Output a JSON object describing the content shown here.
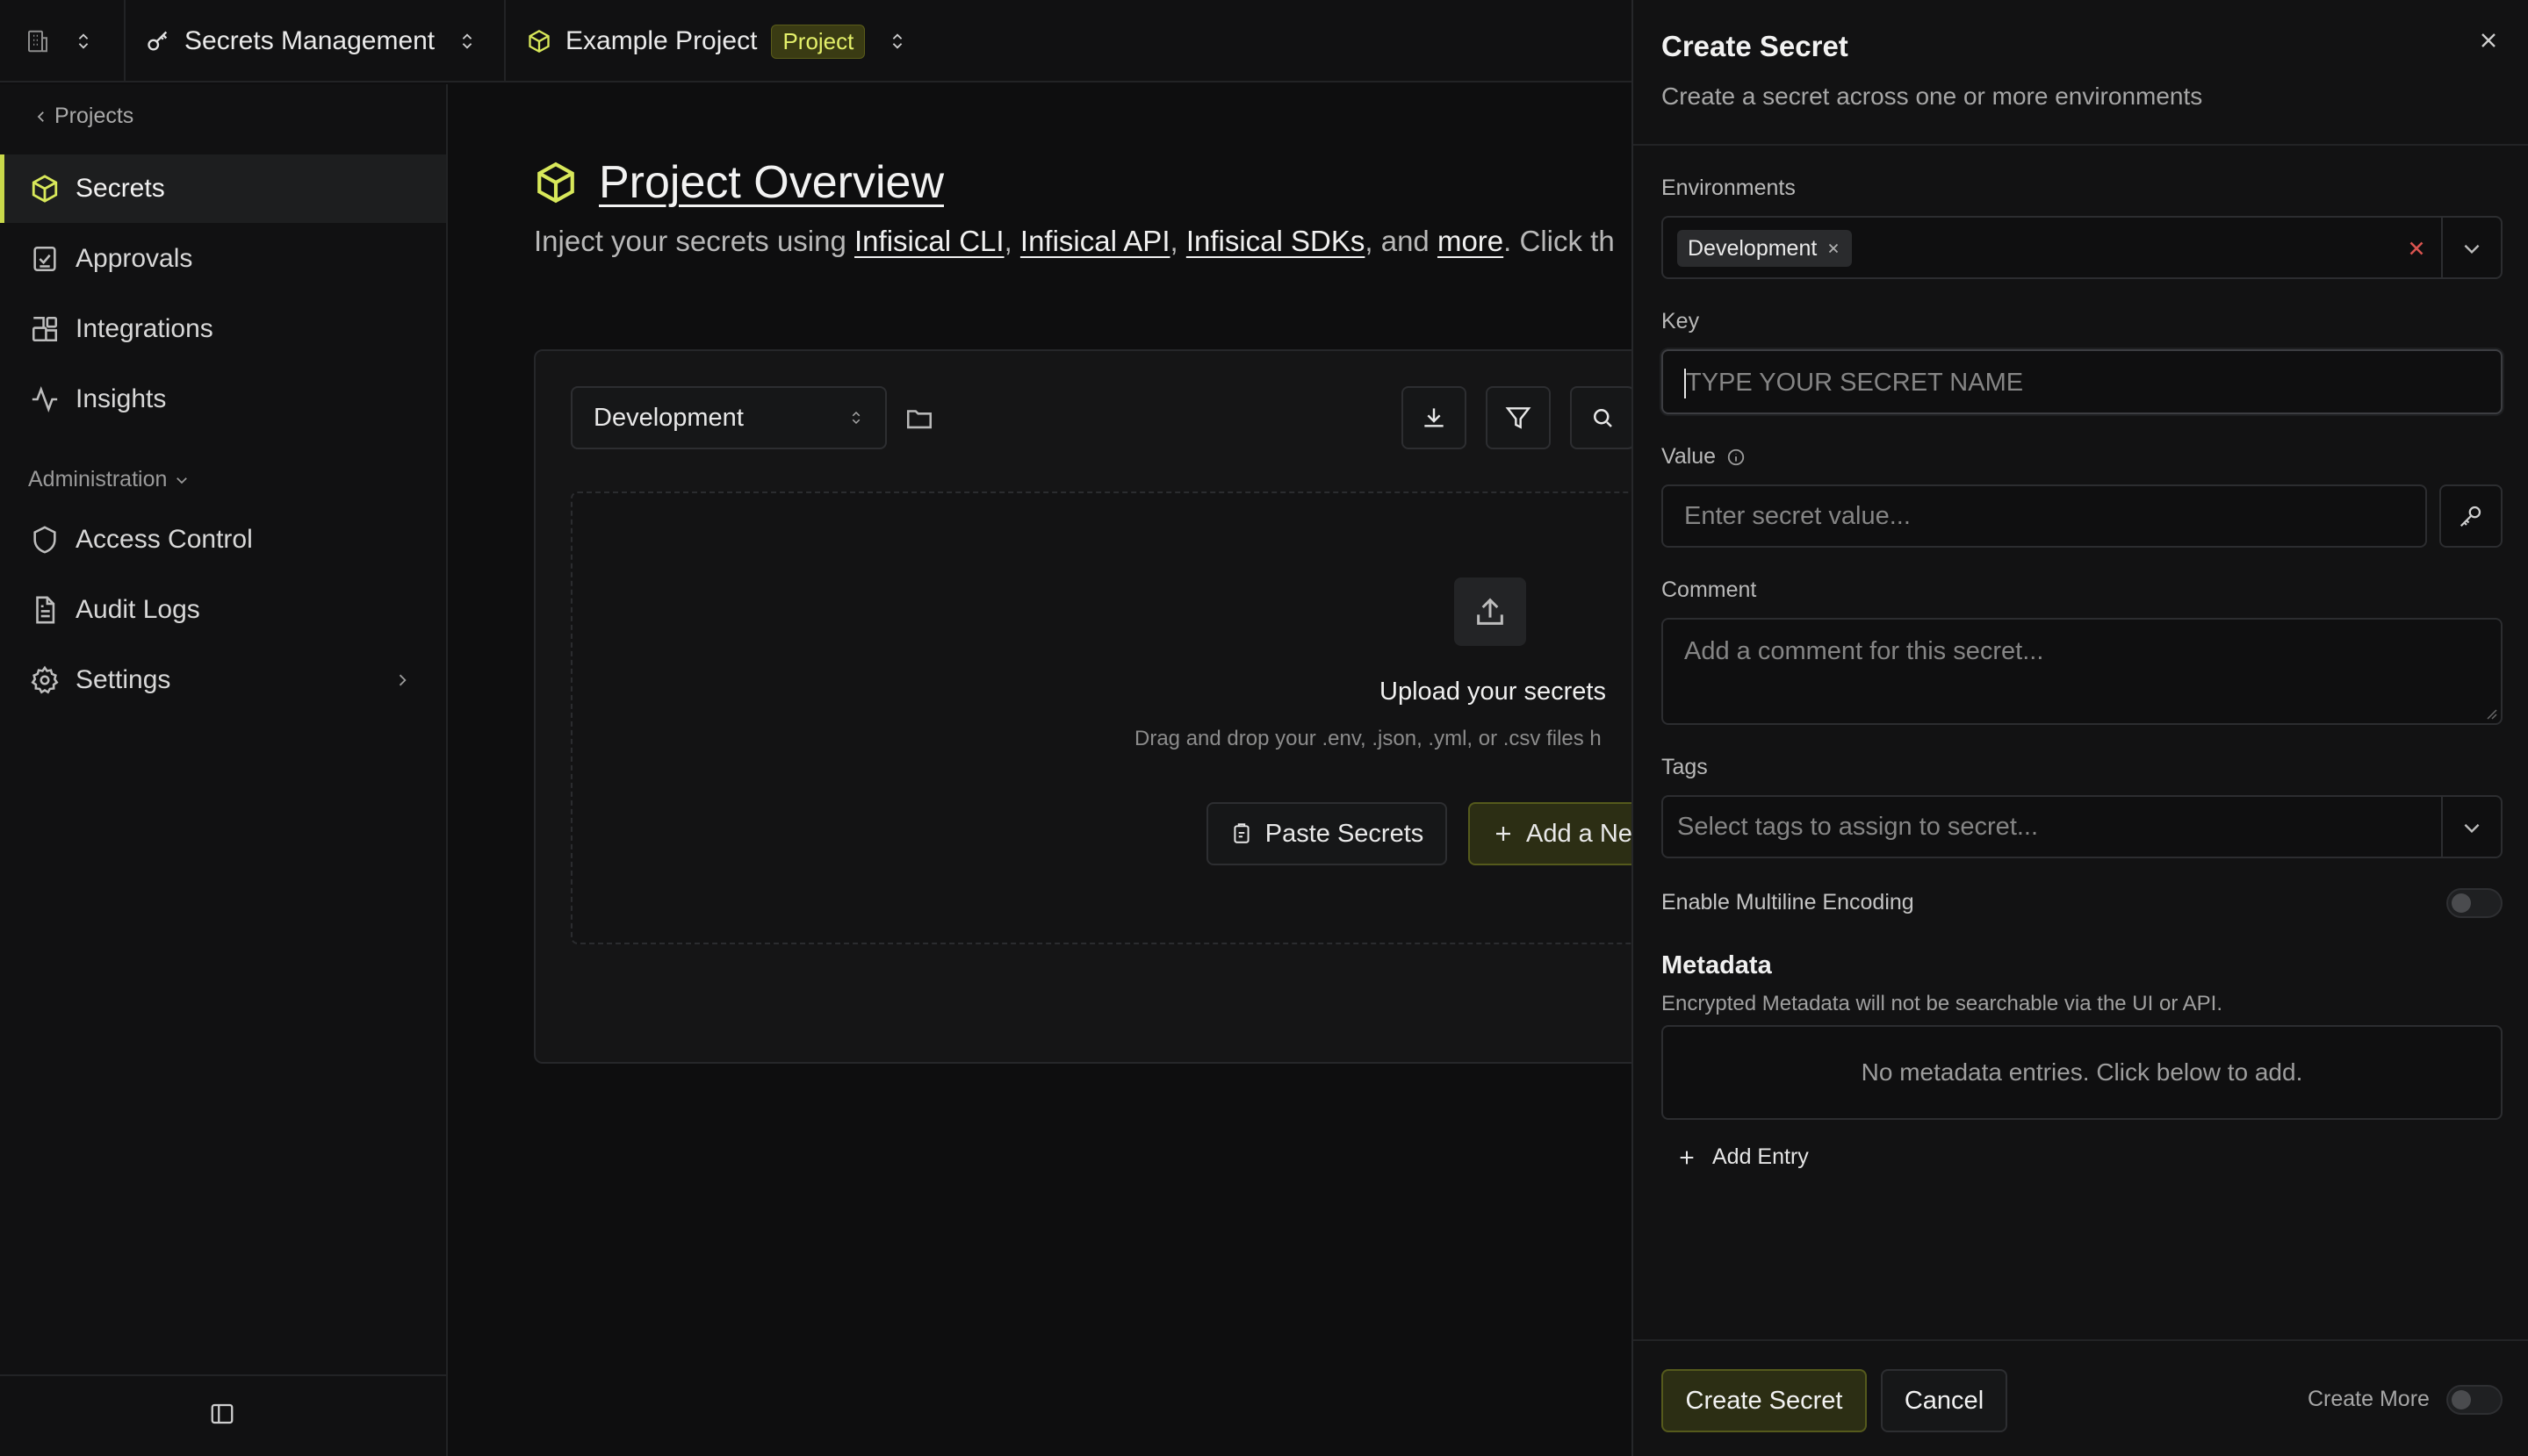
{
  "topbar": {
    "org_icon": "building-icon",
    "product_name": "Secrets Management",
    "project_name": "Example Project",
    "project_badge": "Project"
  },
  "sidebar": {
    "back_label": "Projects",
    "items": [
      {
        "label": "Secrets",
        "icon": "cube-icon",
        "active": true
      },
      {
        "label": "Approvals",
        "icon": "check-square-icon"
      },
      {
        "label": "Integrations",
        "icon": "blocks-icon"
      },
      {
        "label": "Insights",
        "icon": "activity-icon"
      }
    ],
    "admin_section_label": "Administration",
    "admin_items": [
      {
        "label": "Access Control",
        "icon": "shield-icon"
      },
      {
        "label": "Audit Logs",
        "icon": "file-text-icon"
      },
      {
        "label": "Settings",
        "icon": "gear-icon"
      }
    ]
  },
  "main": {
    "title": "Project Overview",
    "description_prefix": "Inject your secrets using ",
    "links": [
      "Infisical CLI",
      "Infisical API",
      "Infisical SDKs"
    ],
    "and_text": ", and ",
    "more_link": "more",
    "description_suffix": ". Click th",
    "environment_select": "Development",
    "upload_title": "Upload your secrets",
    "upload_subtitle": "Drag and drop your .env, .json, .yml, or .csv files h",
    "paste_button": "Paste Secrets",
    "add_button": "Add a Ne"
  },
  "drawer": {
    "title": "Create Secret",
    "subtitle": "Create a secret across one or more environments",
    "environments_label": "Environments",
    "environment_chip": "Development",
    "key_label": "Key",
    "key_placeholder": "TYPE YOUR SECRET NAME",
    "value_label": "Value",
    "value_placeholder": "Enter secret value...",
    "comment_label": "Comment",
    "comment_placeholder": "Add a comment for this secret...",
    "tags_label": "Tags",
    "tags_placeholder": "Select tags to assign to secret...",
    "multiline_label": "Enable Multiline Encoding",
    "metadata_title": "Metadata",
    "metadata_subtitle": "Encrypted Metadata will not be searchable via the UI or API.",
    "metadata_empty": "No metadata entries. Click below to add.",
    "add_entry_label": "Add Entry",
    "create_button": "Create Secret",
    "cancel_button": "Cancel",
    "create_more_label": "Create More"
  },
  "colors": {
    "accent": "#d8e85a",
    "background": "#0e0e0f",
    "panel": "#151516"
  }
}
